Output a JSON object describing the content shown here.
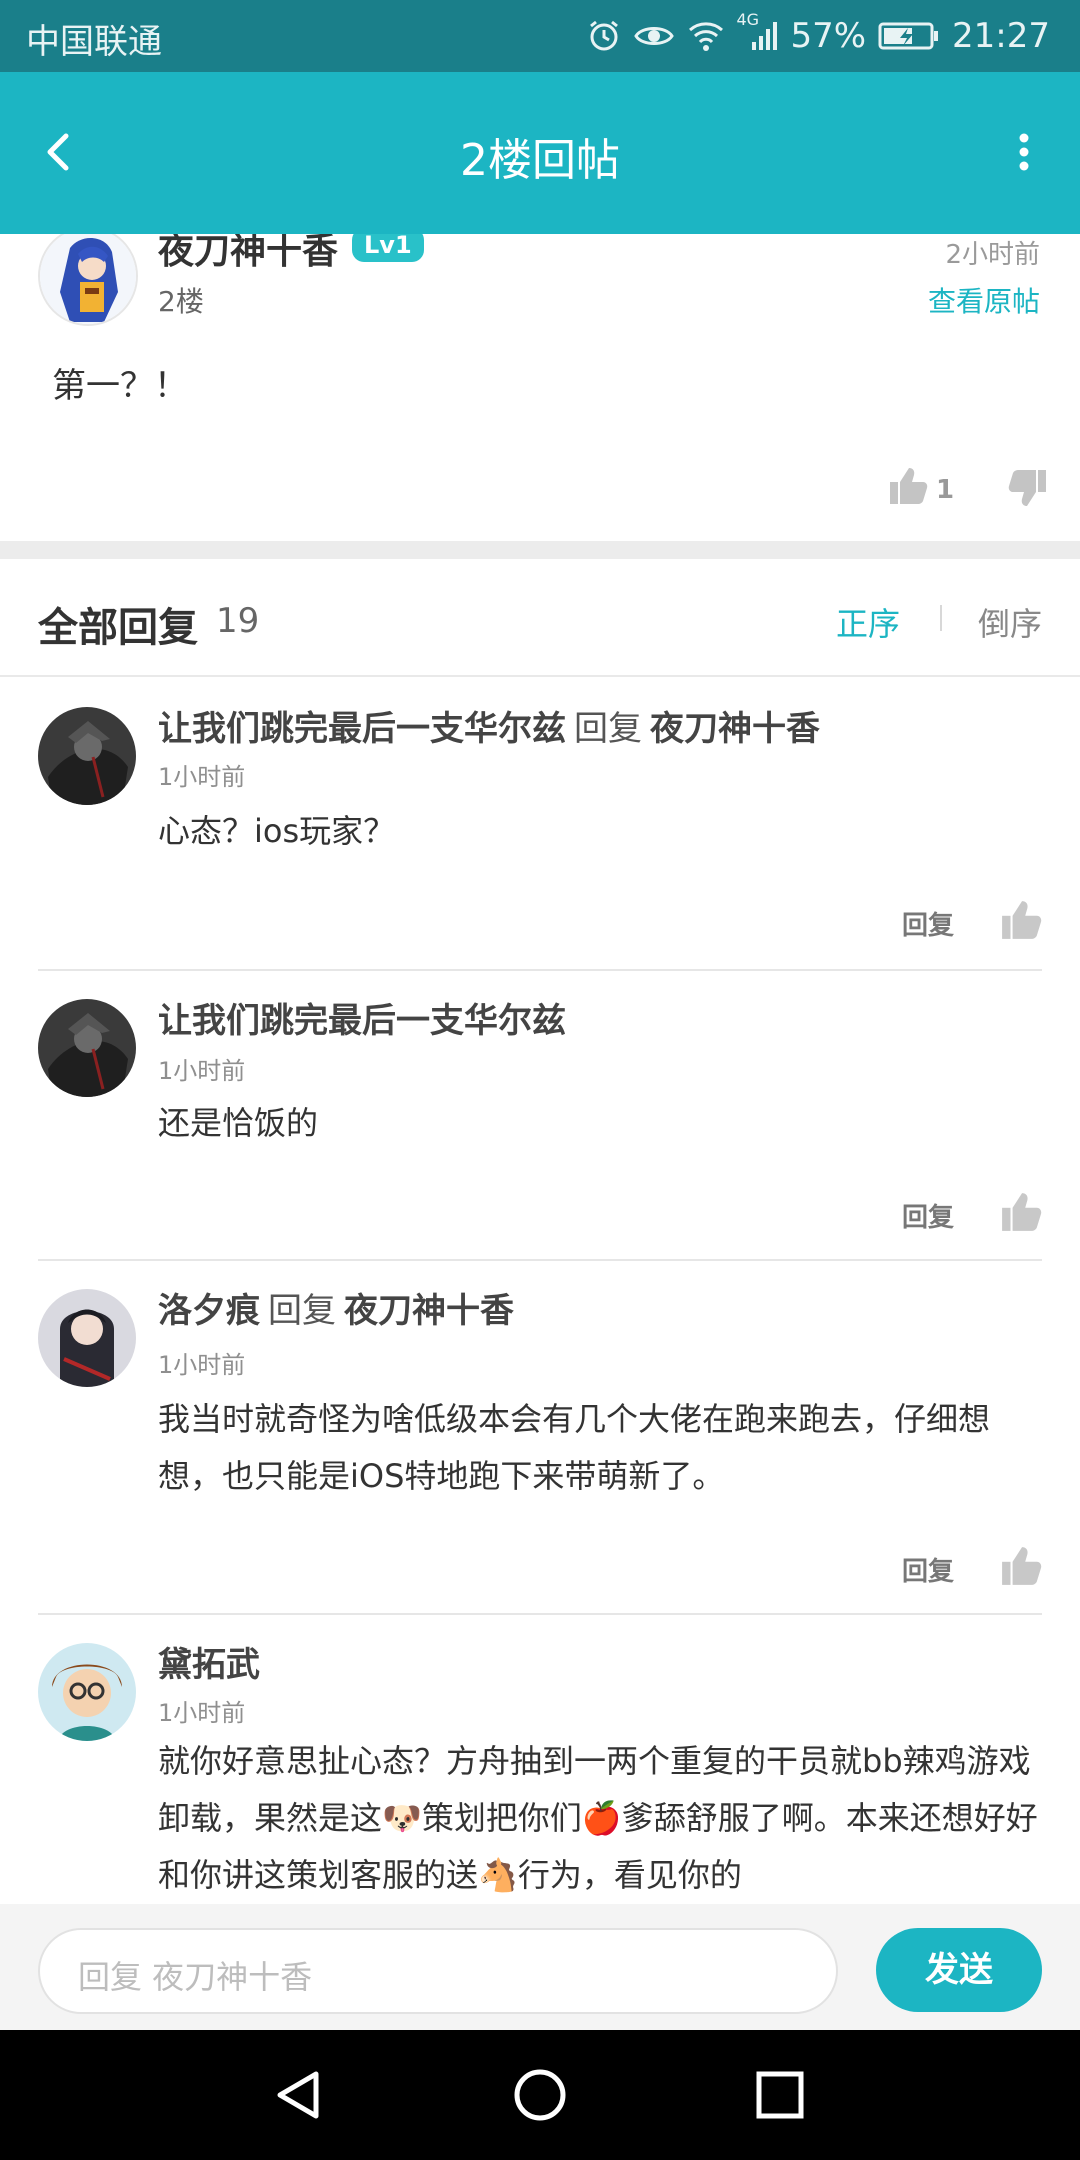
{
  "status_bar": {
    "carrier": "中国联通",
    "network": "4G",
    "battery": "57%",
    "time": "21:27"
  },
  "header": {
    "title": "2楼回帖"
  },
  "post": {
    "author": "夜刀神十香",
    "level": "Lv1",
    "time": "2小时前",
    "floor": "2楼",
    "view_original": "查看原帖",
    "content": "第一？！",
    "like_count": "1"
  },
  "replies_header": {
    "label": "全部回复",
    "count": "19",
    "sort_asc": "正序",
    "sort_desc": "倒序"
  },
  "replies": [
    {
      "author": "让我们跳完最后一支华尔兹",
      "reply_word": "回复",
      "reply_to": "夜刀神十香",
      "time": "1小时前",
      "text": "心态？ios玩家？",
      "reply_btn": "回复"
    },
    {
      "author": "让我们跳完最后一支华尔兹",
      "time": "1小时前",
      "text": "还是恰饭的",
      "reply_btn": "回复"
    },
    {
      "author": "洛夕痕",
      "reply_word": "回复",
      "reply_to": "夜刀神十香",
      "time": "1小时前",
      "text": "我当时就奇怪为啥低级本会有几个大佬在跑来跑去，仔细想想，也只能是iOS特地跑下来带萌新了。",
      "reply_btn": "回复"
    },
    {
      "author": "黛拓武",
      "time": "1小时前",
      "text": "就你好意思扯心态？方舟抽到一两个重复的干员就bb辣鸡游戏卸载，果然是这🐶策划把你们🍎爹舔舒服了啊。本来还想好好和你讲这策划客服的送🐴行为，看见你的"
    }
  ],
  "input": {
    "placeholder": "回复 夜刀神十香",
    "send_label": "发送"
  },
  "colors": {
    "accent": "#1cb5c3",
    "status_bar": "#1a7f8a"
  },
  "icons": [
    "back-arrow-icon",
    "more-vertical-icon",
    "thumbs-up-icon",
    "thumbs-down-icon",
    "alarm-icon",
    "eye-icon",
    "wifi-icon",
    "signal-icon",
    "battery-icon",
    "nav-back-icon",
    "nav-home-icon",
    "nav-recents-icon"
  ]
}
